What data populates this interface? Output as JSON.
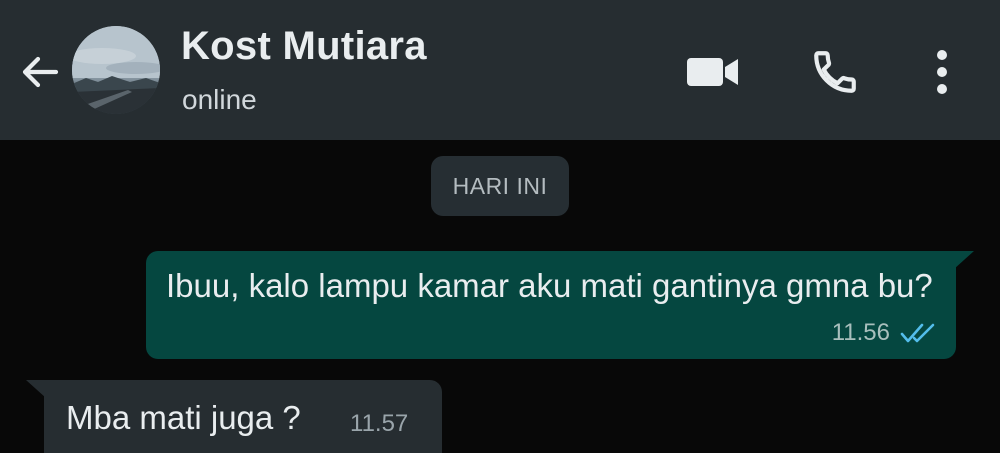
{
  "header": {
    "contact_name": "Kost Mutiara",
    "status": "online",
    "icons": {
      "back": "arrow-left-icon",
      "video": "video-camera-icon",
      "call": "phone-icon",
      "menu": "more-vertical-icon"
    }
  },
  "conversation": {
    "date_divider": "HARI INI",
    "messages": [
      {
        "direction": "outgoing",
        "text": "Ibuu, kalo lampu kamar aku mati gantinya gmna bu?",
        "time": "11.56",
        "status_icon": "double-check-read-icon"
      },
      {
        "direction": "incoming",
        "text": "Mba mati juga ?",
        "time": "11.57"
      }
    ]
  },
  "colors": {
    "header_bg": "#262d31",
    "chat_bg": "#080808",
    "outgoing_bubble": "#054740",
    "incoming_bubble": "#262d31",
    "read_tick": "#53bdeb"
  }
}
